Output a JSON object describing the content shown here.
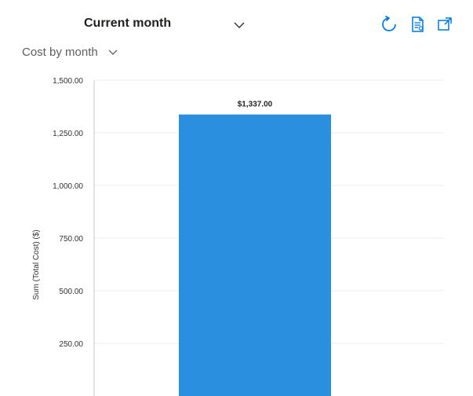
{
  "header": {
    "view_selector": "Current month",
    "icons": {
      "refresh": "refresh-icon",
      "details": "table-details-icon",
      "open": "open-in-new-window-icon"
    }
  },
  "chart_selector": {
    "label": "Cost by month"
  },
  "chart_data": {
    "type": "bar",
    "series": [
      {
        "values": [
          1337.0
        ]
      }
    ],
    "y_ticks": [
      "1,500.00",
      "1,250.00",
      "1,000.00",
      "750.00",
      "500.00",
      "250.00"
    ],
    "tick_values": [
      1500,
      1250,
      1000,
      750,
      500,
      250
    ],
    "ylabel": "Sum (Total Cost) ($)",
    "data_labels": [
      "$1,337.00"
    ],
    "ylim": [
      0,
      1500
    ],
    "grid": true,
    "legend": "none",
    "colors": {
      "bar": "#2b8fe0",
      "grid": "#ececec",
      "axis": "#c8c6c4"
    }
  }
}
